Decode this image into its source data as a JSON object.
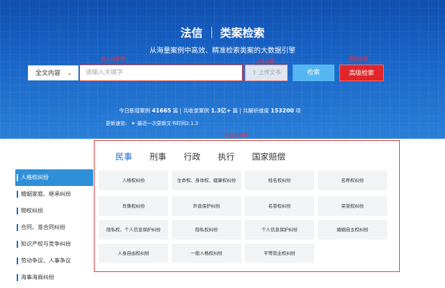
{
  "header": {
    "brand": "法信",
    "product": "类案检索",
    "subtitle": "从海量案例中高效、精准检索类案的大数据引擎"
  },
  "annotations": {
    "search_box": "输入检索框",
    "upload": "上传文档",
    "advanced": "高级检索",
    "nav": "导出式检索"
  },
  "search": {
    "scope": "全文内容",
    "placeholder": "请输入关键字",
    "upload_label": "上传文书",
    "search_label": "检索",
    "advanced_label": "高级检索"
  },
  "stats": {
    "today_label": "今日新增案例",
    "today_value": "41665",
    "today_unit": "篇",
    "total_label": "共收录案例",
    "total_value": "1.3亿+",
    "total_unit": "篇",
    "dims_label": "共解析维度",
    "dims_value": "153200",
    "dims_unit": "项",
    "sep": "|"
  },
  "update": {
    "label": "更新速览:",
    "text": "最近一次更新文书时间2.1.3"
  },
  "sidebar": {
    "items": [
      {
        "label": "人格权纠纷"
      },
      {
        "label": "婚姻家庭、继承纠纷"
      },
      {
        "label": "物权纠纷"
      },
      {
        "label": "合同、准合同纠纷"
      },
      {
        "label": "知识产权与竞争纠纷"
      },
      {
        "label": "劳动争议、人事争议"
      },
      {
        "label": "海事海商纠纷"
      }
    ]
  },
  "tabs": [
    "民事",
    "刑事",
    "行政",
    "执行",
    "国家赔偿"
  ],
  "cases": [
    "人格权纠纷",
    "生命权、身体权、健康权纠纷",
    "姓名权纠纷",
    "名称权纠纷",
    "肖像权纠纷",
    "声音保护纠纷",
    "名誉权纠纷",
    "荣誉权纠纷",
    "隐私权、个人信息保护纠纷",
    "隐私权纠纷",
    "个人信息保护纠纷",
    "婚姻自主权纠纷",
    "人身自由权纠纷",
    "一般人格权纠纷",
    "平等就业权纠纷"
  ]
}
